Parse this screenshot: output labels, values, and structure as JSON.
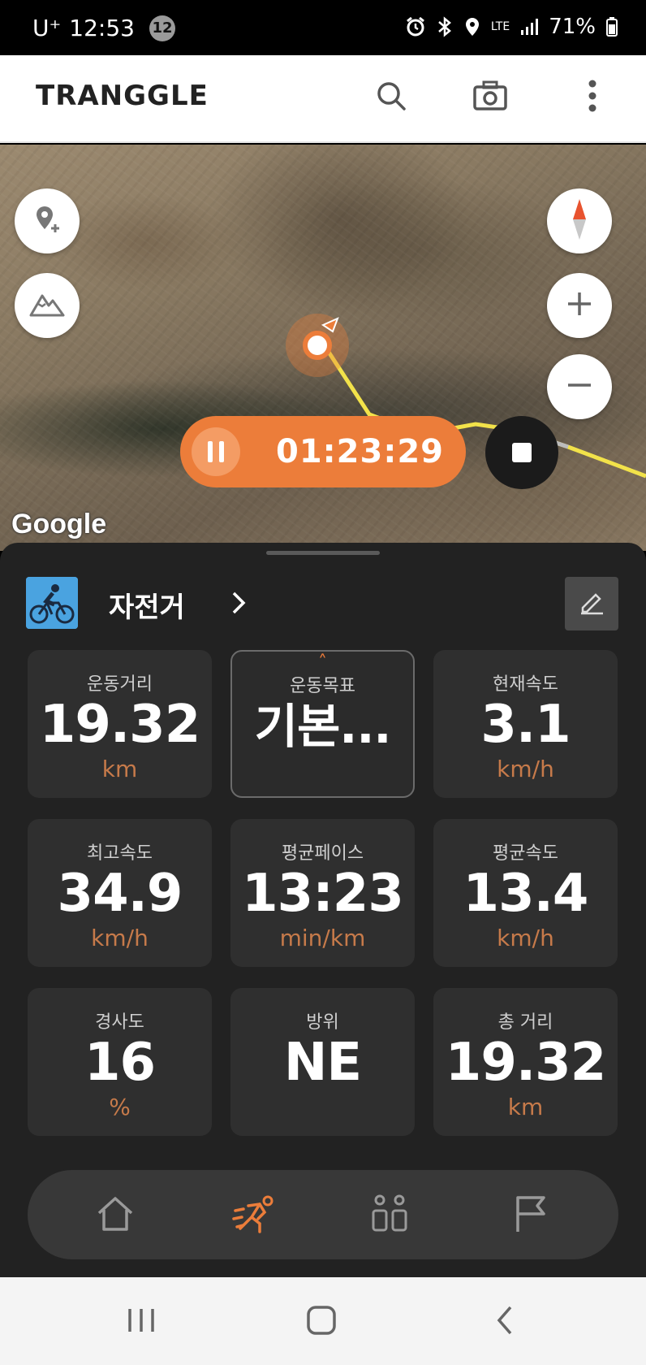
{
  "status_bar": {
    "carrier": "U⁺",
    "time": "12:53",
    "notification_count": "12",
    "network": "LTE",
    "battery": "71%"
  },
  "app_bar": {
    "logo": "TRANGGLE",
    "icons": [
      "search-icon",
      "camera-icon",
      "more-vert-icon"
    ]
  },
  "map": {
    "attribution": "Google",
    "timer": "01:23:29",
    "left_buttons": [
      "add-location-icon",
      "mountain-icon"
    ],
    "right_buttons": [
      "compass-icon",
      "zoom-in-icon",
      "zoom-out-icon"
    ],
    "route_color": "#f2e24a"
  },
  "activity": {
    "label": "자전거"
  },
  "stats": [
    {
      "label": "운동거리",
      "value": "19.32",
      "unit": "km"
    },
    {
      "label": "운동목표",
      "value": "기본...",
      "unit": ""
    },
    {
      "label": "현재속도",
      "value": "3.1",
      "unit": "km/h"
    },
    {
      "label": "최고속도",
      "value": "34.9",
      "unit": "km/h"
    },
    {
      "label": "평균페이스",
      "value": "13:23",
      "unit": "min/km"
    },
    {
      "label": "평균속도",
      "value": "13.4",
      "unit": "km/h"
    },
    {
      "label": "경사도",
      "value": "16",
      "unit": "%"
    },
    {
      "label": "방위",
      "value": "NE",
      "unit": ""
    },
    {
      "label": "총 거리",
      "value": "19.32",
      "unit": "km"
    }
  ],
  "bottom_nav": [
    "home-icon",
    "activity-icon",
    "people-icon",
    "flag-icon"
  ],
  "colors": {
    "accent": "#ec7d3a",
    "unit": "#c67a4a",
    "sheet": "#222222",
    "card": "#2f2f2f"
  }
}
